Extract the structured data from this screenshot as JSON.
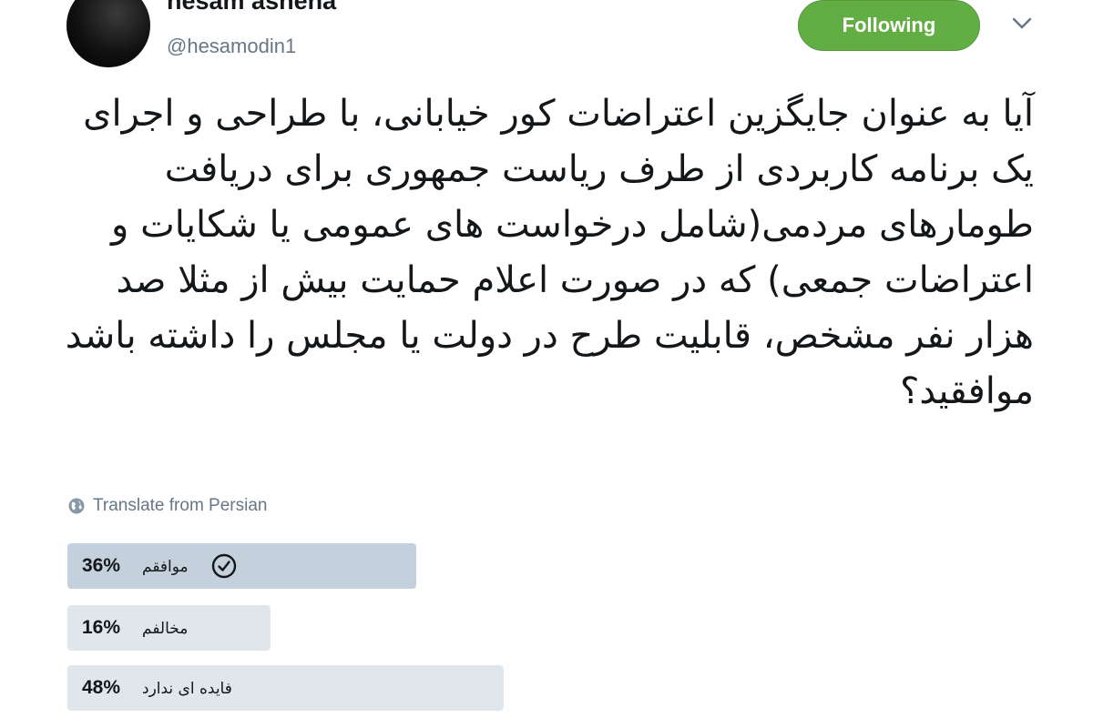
{
  "author": {
    "name": "hesam ashena",
    "handle": "@hesamodin1"
  },
  "follow_button": {
    "label": "Following"
  },
  "tweet": {
    "text": "آیا به عنوان جایگزین اعتراضات کور خیابانی، با طراحی و اجرای یک برنامه کاربردی از طرف ریاست جمهوری برای دریافت طومارهای مردمی(شامل درخواست های عمومی یا شکایات و اعتراضات جمعی) که در صورت اعلام حمایت بیش از مثلا صد هزار نفر مشخص، قابلیت طرح در دولت یا مجلس را داشته باشد موافقید؟"
  },
  "translate": {
    "label": "Translate from Persian",
    "icon": "globe-icon"
  },
  "poll": {
    "options": [
      {
        "percent": "36%",
        "value": 36,
        "label": "موافقم",
        "selected": true,
        "bar_color": "#c4d1dc"
      },
      {
        "percent": "16%",
        "value": 16,
        "label": "مخالفم",
        "selected": false,
        "bar_color": "#dfe6ec"
      },
      {
        "percent": "48%",
        "value": 48,
        "label": "فایده ای ندارد",
        "selected": false,
        "bar_color": "#dfe6ec"
      }
    ]
  },
  "colors": {
    "follow_button": "#63ad45",
    "handle": "#657786",
    "text": "#14171a"
  }
}
